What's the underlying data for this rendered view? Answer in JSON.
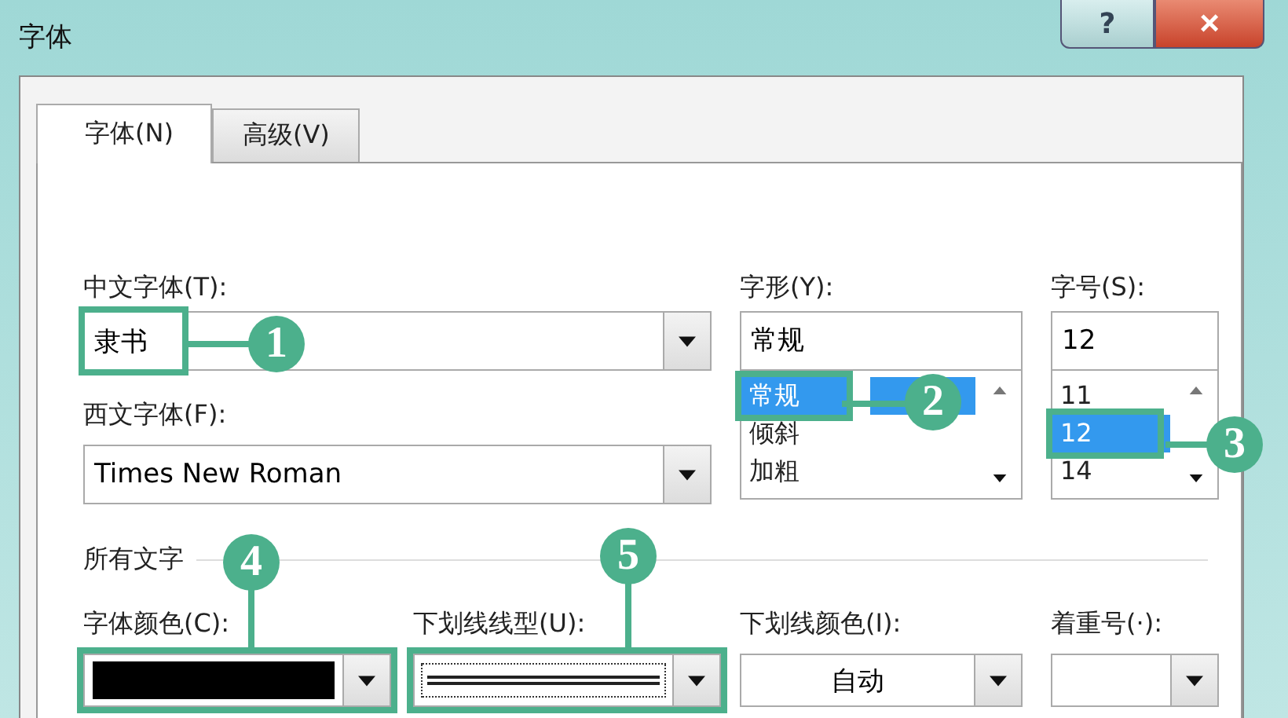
{
  "window": {
    "title": "字体",
    "help": "?",
    "close": "×"
  },
  "tabs": [
    {
      "label": "字体(N)",
      "selected": true
    },
    {
      "label": "高级(V)",
      "selected": false
    }
  ],
  "chinese_font": {
    "label": "中文字体(T):",
    "value": "隶书"
  },
  "western_font": {
    "label": "西文字体(F):",
    "value": "Times New Roman"
  },
  "style": {
    "label": "字形(Y):",
    "value": "常规",
    "items": [
      {
        "label": "常规",
        "selected": true
      },
      {
        "label": "倾斜",
        "selected": false
      },
      {
        "label": "加粗",
        "selected": false
      }
    ]
  },
  "size": {
    "label": "字号(S):",
    "value": "12",
    "items": [
      {
        "label": "11",
        "selected": false
      },
      {
        "label": "12",
        "selected": true
      },
      {
        "label": "14",
        "selected": false
      }
    ]
  },
  "all_text": {
    "heading": "所有文字",
    "font_color": {
      "label": "字体颜色(C):",
      "color": "#000000"
    },
    "underline_style": {
      "label": "下划线线型(U):"
    },
    "underline_color": {
      "label": "下划线颜色(I):",
      "value": "自动"
    },
    "emphasis_mark": {
      "label": "着重号(·):"
    }
  },
  "callouts": [
    {
      "number": "1"
    },
    {
      "number": "2"
    },
    {
      "number": "3"
    },
    {
      "number": "4"
    },
    {
      "number": "5"
    }
  ]
}
